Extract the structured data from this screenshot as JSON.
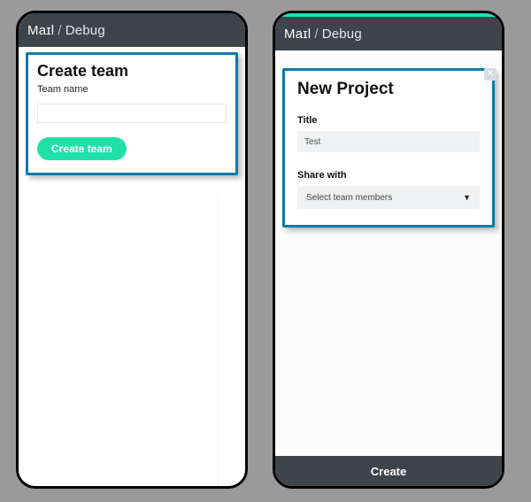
{
  "brand": {
    "name": "Maɪl",
    "separator": "/",
    "page": "Debug"
  },
  "left": {
    "heading": "Create team",
    "team_name_label": "Team name",
    "team_name_value": "",
    "create_button": "Create team"
  },
  "right": {
    "modal_title": "New Project",
    "title_label": "Title",
    "title_value": "Test",
    "share_label": "Share with",
    "share_placeholder": "Select team members",
    "footer_button": "Create"
  },
  "colors": {
    "accent_teal": "#20e0a8",
    "highlight_blue": "#0a7aa8",
    "header_bg": "#3e444b"
  }
}
